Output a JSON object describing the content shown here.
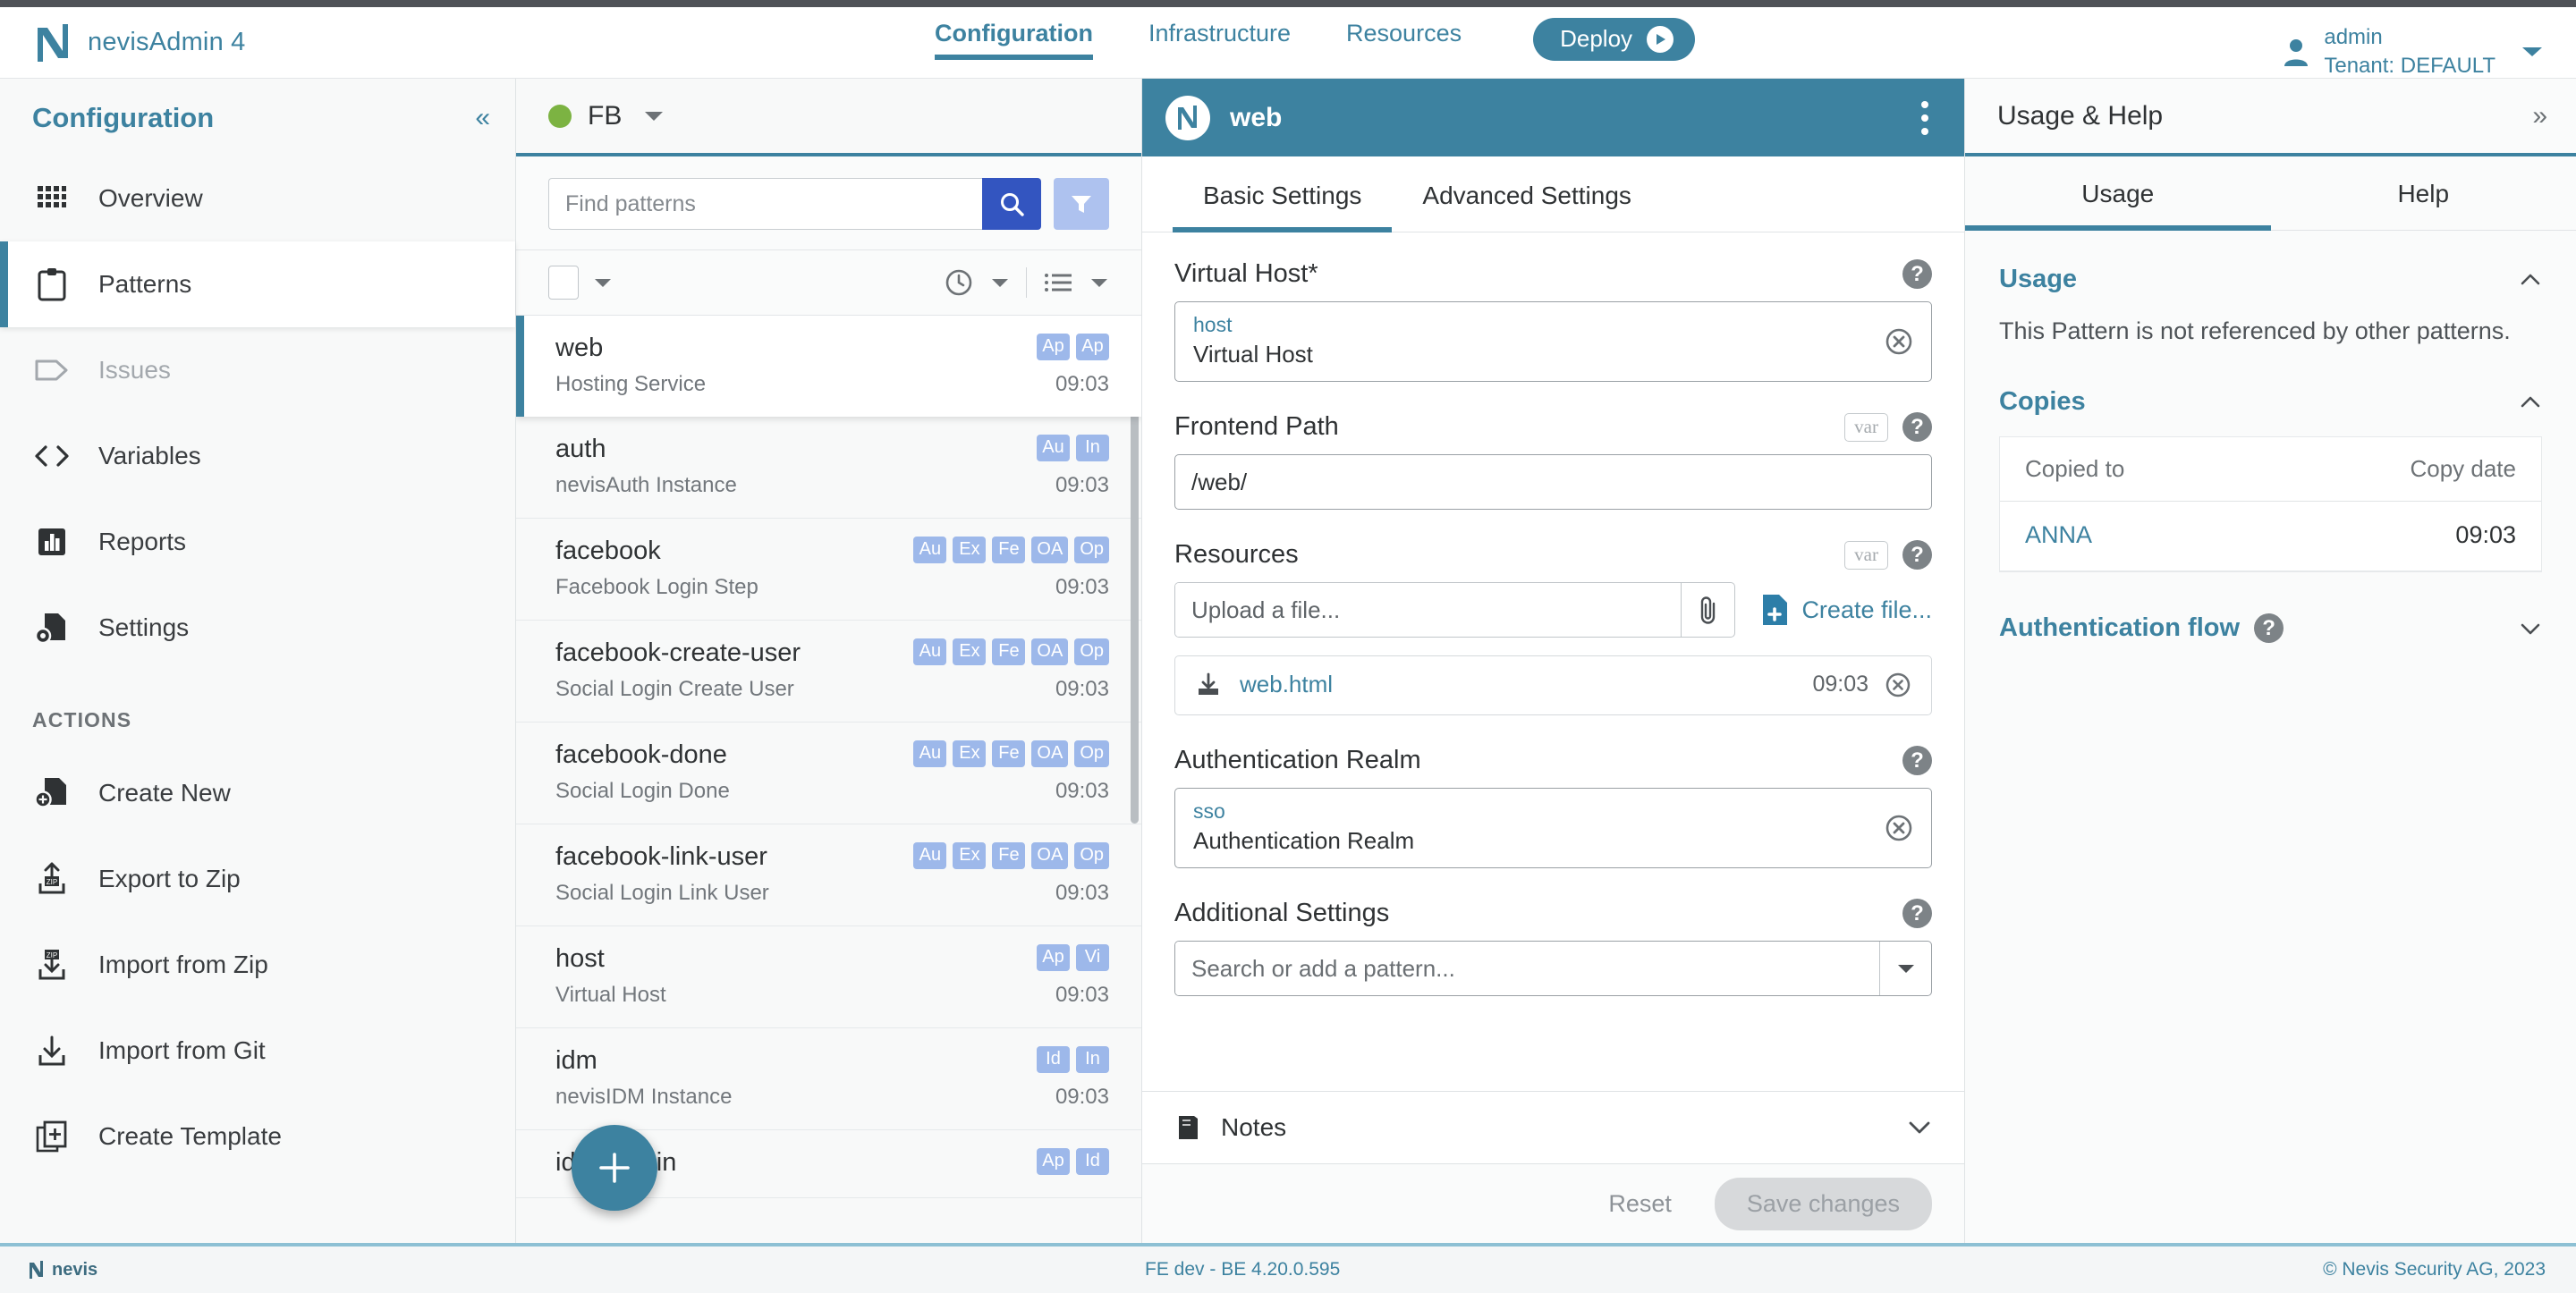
{
  "app": {
    "brand_name": "nevisAdmin 4",
    "logo_icon": "nevis-logo-icon"
  },
  "topnav": {
    "items": [
      {
        "label": "Configuration",
        "active": true
      },
      {
        "label": "Infrastructure",
        "active": false
      },
      {
        "label": "Resources",
        "active": false
      }
    ],
    "deploy_label": "Deploy",
    "deploy_icon": "play-circle-icon"
  },
  "user": {
    "icon": "user-icon",
    "name": "admin",
    "tenant": "Tenant: DEFAULT",
    "caret_icon": "caret-down-icon"
  },
  "sidebar": {
    "title": "Configuration",
    "collapse_icon": "chevron-double-left-icon",
    "items": [
      {
        "label": "Overview",
        "icon": "grid-icon",
        "state": "normal"
      },
      {
        "label": "Patterns",
        "icon": "clipboard-icon",
        "state": "active"
      },
      {
        "label": "Issues",
        "icon": "tag-icon",
        "state": "disabled"
      },
      {
        "label": "Variables",
        "icon": "code-brackets-icon",
        "state": "normal"
      },
      {
        "label": "Reports",
        "icon": "bar-chart-icon",
        "state": "normal"
      },
      {
        "label": "Settings",
        "icon": "file-gear-icon",
        "state": "normal"
      }
    ],
    "actions_header": "ACTIONS",
    "actions": [
      {
        "label": "Create New",
        "icon": "file-plus-icon"
      },
      {
        "label": "Export to Zip",
        "icon": "zip-upload-icon"
      },
      {
        "label": "Import from Zip",
        "icon": "zip-download-icon"
      },
      {
        "label": "Import from Git",
        "icon": "download-icon"
      },
      {
        "label": "Create Template",
        "icon": "copy-plus-icon"
      }
    ]
  },
  "list_panel": {
    "env_name": "FB",
    "env_status_color": "#7cb342",
    "env_caret_icon": "caret-down-icon",
    "search_placeholder": "Find patterns",
    "search_value": "",
    "search_icon": "search-icon",
    "filter_icon": "filter-icon",
    "toolbar": {
      "select_all_icon": "checkbox-icon",
      "select_caret_icon": "caret-down-icon",
      "sort_icon": "clock-icon",
      "sort_caret_icon": "caret-down-icon",
      "view_icon": "list-view-icon",
      "view_caret_icon": "caret-down-icon"
    },
    "add_button_icon": "plus-icon",
    "patterns": [
      {
        "name": "web",
        "description": "Hosting Service",
        "time": "09:03",
        "badges": [
          "Ap",
          "Ap"
        ],
        "selected": true
      },
      {
        "name": "auth",
        "description": "nevisAuth Instance",
        "time": "09:03",
        "badges": [
          "Au",
          "In"
        ],
        "selected": false
      },
      {
        "name": "facebook",
        "description": "Facebook Login Step",
        "time": "09:03",
        "badges": [
          "Au",
          "Ex",
          "Fe",
          "OA",
          "Op"
        ],
        "selected": false
      },
      {
        "name": "facebook-create-user",
        "description": "Social Login Create User",
        "time": "09:03",
        "badges": [
          "Au",
          "Ex",
          "Fe",
          "OA",
          "Op"
        ],
        "selected": false
      },
      {
        "name": "facebook-done",
        "description": "Social Login Done",
        "time": "09:03",
        "badges": [
          "Au",
          "Ex",
          "Fe",
          "OA",
          "Op"
        ],
        "selected": false
      },
      {
        "name": "facebook-link-user",
        "description": "Social Login Link User",
        "time": "09:03",
        "badges": [
          "Au",
          "Ex",
          "Fe",
          "OA",
          "Op"
        ],
        "selected": false
      },
      {
        "name": "host",
        "description": "Virtual Host",
        "time": "09:03",
        "badges": [
          "Ap",
          "Vi"
        ],
        "selected": false
      },
      {
        "name": "idm",
        "description": "nevisIDM Instance",
        "time": "09:03",
        "badges": [
          "Id",
          "In"
        ],
        "selected": false
      },
      {
        "name": "idm-admin",
        "description": "",
        "time": "",
        "badges": [
          "Ap",
          "Id"
        ],
        "selected": false
      }
    ]
  },
  "detail": {
    "title": "web",
    "logo_icon": "nevis-logo-icon",
    "menu_icon": "kebab-menu-icon",
    "tabs": [
      {
        "label": "Basic Settings",
        "active": true
      },
      {
        "label": "Advanced Settings",
        "active": false
      }
    ],
    "fields": {
      "virtual_host": {
        "label": "Virtual Host*",
        "ref_name": "host",
        "ref_type": "Virtual Host",
        "help_icon": "help-icon",
        "clear_icon": "clear-circle-icon"
      },
      "frontend_path": {
        "label": "Frontend Path",
        "value": "/web/",
        "var_chip": "var",
        "help_icon": "help-icon"
      },
      "resources": {
        "label": "Resources",
        "var_chip": "var",
        "help_icon": "help-icon",
        "upload_placeholder": "Upload a file...",
        "upload_value": "",
        "attach_icon": "paperclip-icon",
        "create_file_label": "Create file...",
        "create_file_icon": "file-plus-icon",
        "files": [
          {
            "name": "web.html",
            "time": "09:03",
            "download_icon": "download-icon",
            "remove_icon": "clear-circle-icon"
          }
        ]
      },
      "auth_realm": {
        "label": "Authentication Realm",
        "ref_name": "sso",
        "ref_type": "Authentication Realm",
        "help_icon": "help-icon",
        "clear_icon": "clear-circle-icon"
      },
      "additional_settings": {
        "label": "Additional Settings",
        "help_icon": "help-icon",
        "placeholder": "Search or add a pattern...",
        "value": "",
        "dropdown_icon": "caret-down-icon"
      }
    },
    "notes": {
      "label": "Notes",
      "icon": "book-icon",
      "chevron_icon": "chevron-down-icon"
    },
    "footer": {
      "reset_label": "Reset",
      "save_label": "Save changes"
    }
  },
  "right_panel": {
    "title": "Usage & Help",
    "expand_icon": "chevron-double-right-icon",
    "tabs": [
      {
        "label": "Usage",
        "active": true
      },
      {
        "label": "Help",
        "active": false
      }
    ],
    "usage": {
      "section_title": "Usage",
      "chevron_icon": "chevron-up-icon",
      "text": "This Pattern is not referenced by other patterns."
    },
    "copies": {
      "section_title": "Copies",
      "chevron_icon": "chevron-up-icon",
      "columns": [
        "Copied to",
        "Copy date"
      ],
      "rows": [
        {
          "copied_to": "ANNA",
          "copy_date": "09:03"
        }
      ]
    },
    "auth_flow": {
      "section_title": "Authentication flow",
      "help_icon": "help-icon",
      "chevron_icon": "chevron-down-icon"
    }
  },
  "footer": {
    "logo_text": "nevis",
    "version": "FE dev - BE 4.20.0.595",
    "copyright": "© Nevis Security AG, 2023"
  },
  "colors": {
    "accent": "#3d82a0",
    "badge": "#9db8ea",
    "search_btn": "#3355c0",
    "filter_btn": "#aec2ef",
    "status_green": "#7cb342",
    "footer_rule": "#8dc0d4"
  }
}
